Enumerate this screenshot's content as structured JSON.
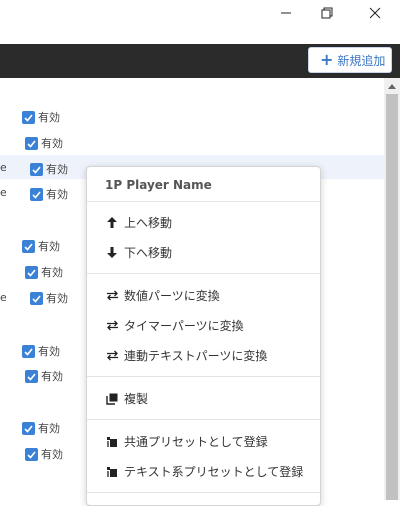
{
  "toolbar": {
    "add_label": "新規追加",
    "add_icon": "plus-icon"
  },
  "list": {
    "checkbox_label": "有効",
    "edge_text": "e"
  },
  "context_menu": {
    "header": "1P Player Name",
    "items": [
      {
        "label": "上へ移動",
        "icon": "arrow-up-icon"
      },
      {
        "label": "下へ移動",
        "icon": "arrow-down-icon"
      },
      {
        "label": "数値パーツに変換",
        "icon": "swap-icon"
      },
      {
        "label": "タイマーパーツに変換",
        "icon": "swap-icon"
      },
      {
        "label": "連動テキストパーツに変換",
        "icon": "swap-icon"
      },
      {
        "label": "複製",
        "icon": "copy-icon"
      },
      {
        "label": "共通プリセットとして登録",
        "icon": "preset-icon"
      },
      {
        "label": "テキスト系プリセットとして登録",
        "icon": "preset-icon"
      }
    ]
  },
  "colors": {
    "accent": "#3b82d6",
    "toolbar_bg": "#2b2b2b",
    "highlight_row": "#eef3fb"
  }
}
